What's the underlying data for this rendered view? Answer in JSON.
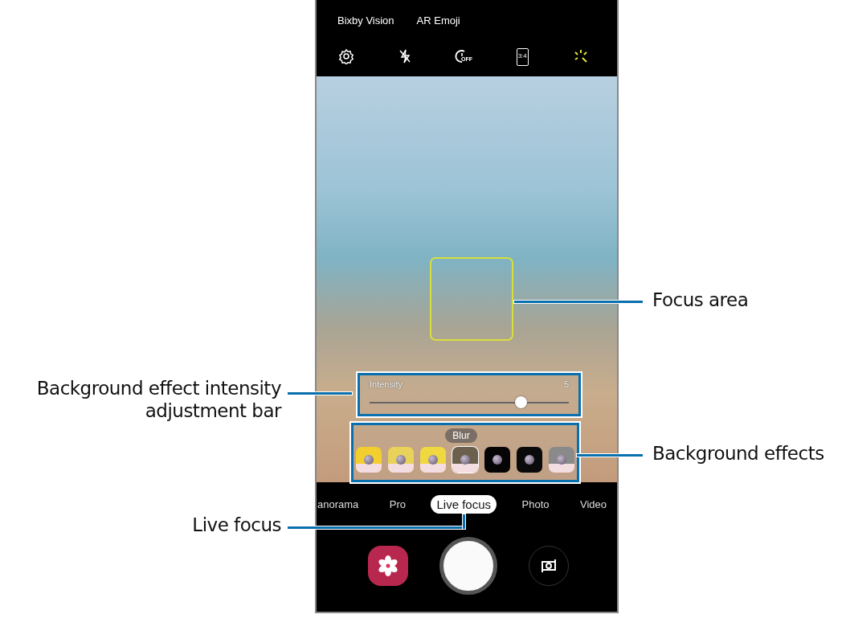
{
  "top_modes": [
    {
      "label": "Bixby Vision"
    },
    {
      "label": "AR Emoji"
    }
  ],
  "toolbar": [
    {
      "kind": "settings",
      "on": false
    },
    {
      "kind": "flash",
      "on": false
    },
    {
      "kind": "timer",
      "label": "OFF",
      "on": false
    },
    {
      "kind": "ratio",
      "label": "3:4",
      "on": false
    },
    {
      "kind": "effects",
      "on": true
    }
  ],
  "intensity": {
    "label": "Intensity",
    "reading": "5",
    "level": 0.76
  },
  "effects": {
    "tooltip": "Blur",
    "items": [
      {
        "kind": "split",
        "color": "#f2cf2e",
        "selected": false
      },
      {
        "kind": "split",
        "color": "#e8d25a",
        "selected": false
      },
      {
        "kind": "split",
        "color": "#f0d840",
        "selected": false
      },
      {
        "kind": "split",
        "color": "#6b5f4d",
        "selected": true
      },
      {
        "kind": "solid",
        "color": "#050505",
        "selected": false
      },
      {
        "kind": "solid",
        "color": "#0a0a0a",
        "selected": false
      },
      {
        "kind": "split",
        "color": "#8a8a8a",
        "selected": false
      }
    ]
  },
  "modes": [
    {
      "label": "anorama",
      "selected": false
    },
    {
      "label": "Pro",
      "selected": false
    },
    {
      "label": "Live focus",
      "selected": true
    },
    {
      "label": "Photo",
      "selected": false
    },
    {
      "label": "Video",
      "selected": false
    }
  ],
  "controls": [
    {
      "kind": "gallery"
    },
    {
      "kind": "shutter"
    },
    {
      "kind": "switch"
    }
  ],
  "annotations": [
    {
      "label": "Focus area"
    },
    {
      "label": "Background effect intensity adjustment bar"
    },
    {
      "label": "Background effects"
    },
    {
      "label": "Live focus"
    }
  ]
}
